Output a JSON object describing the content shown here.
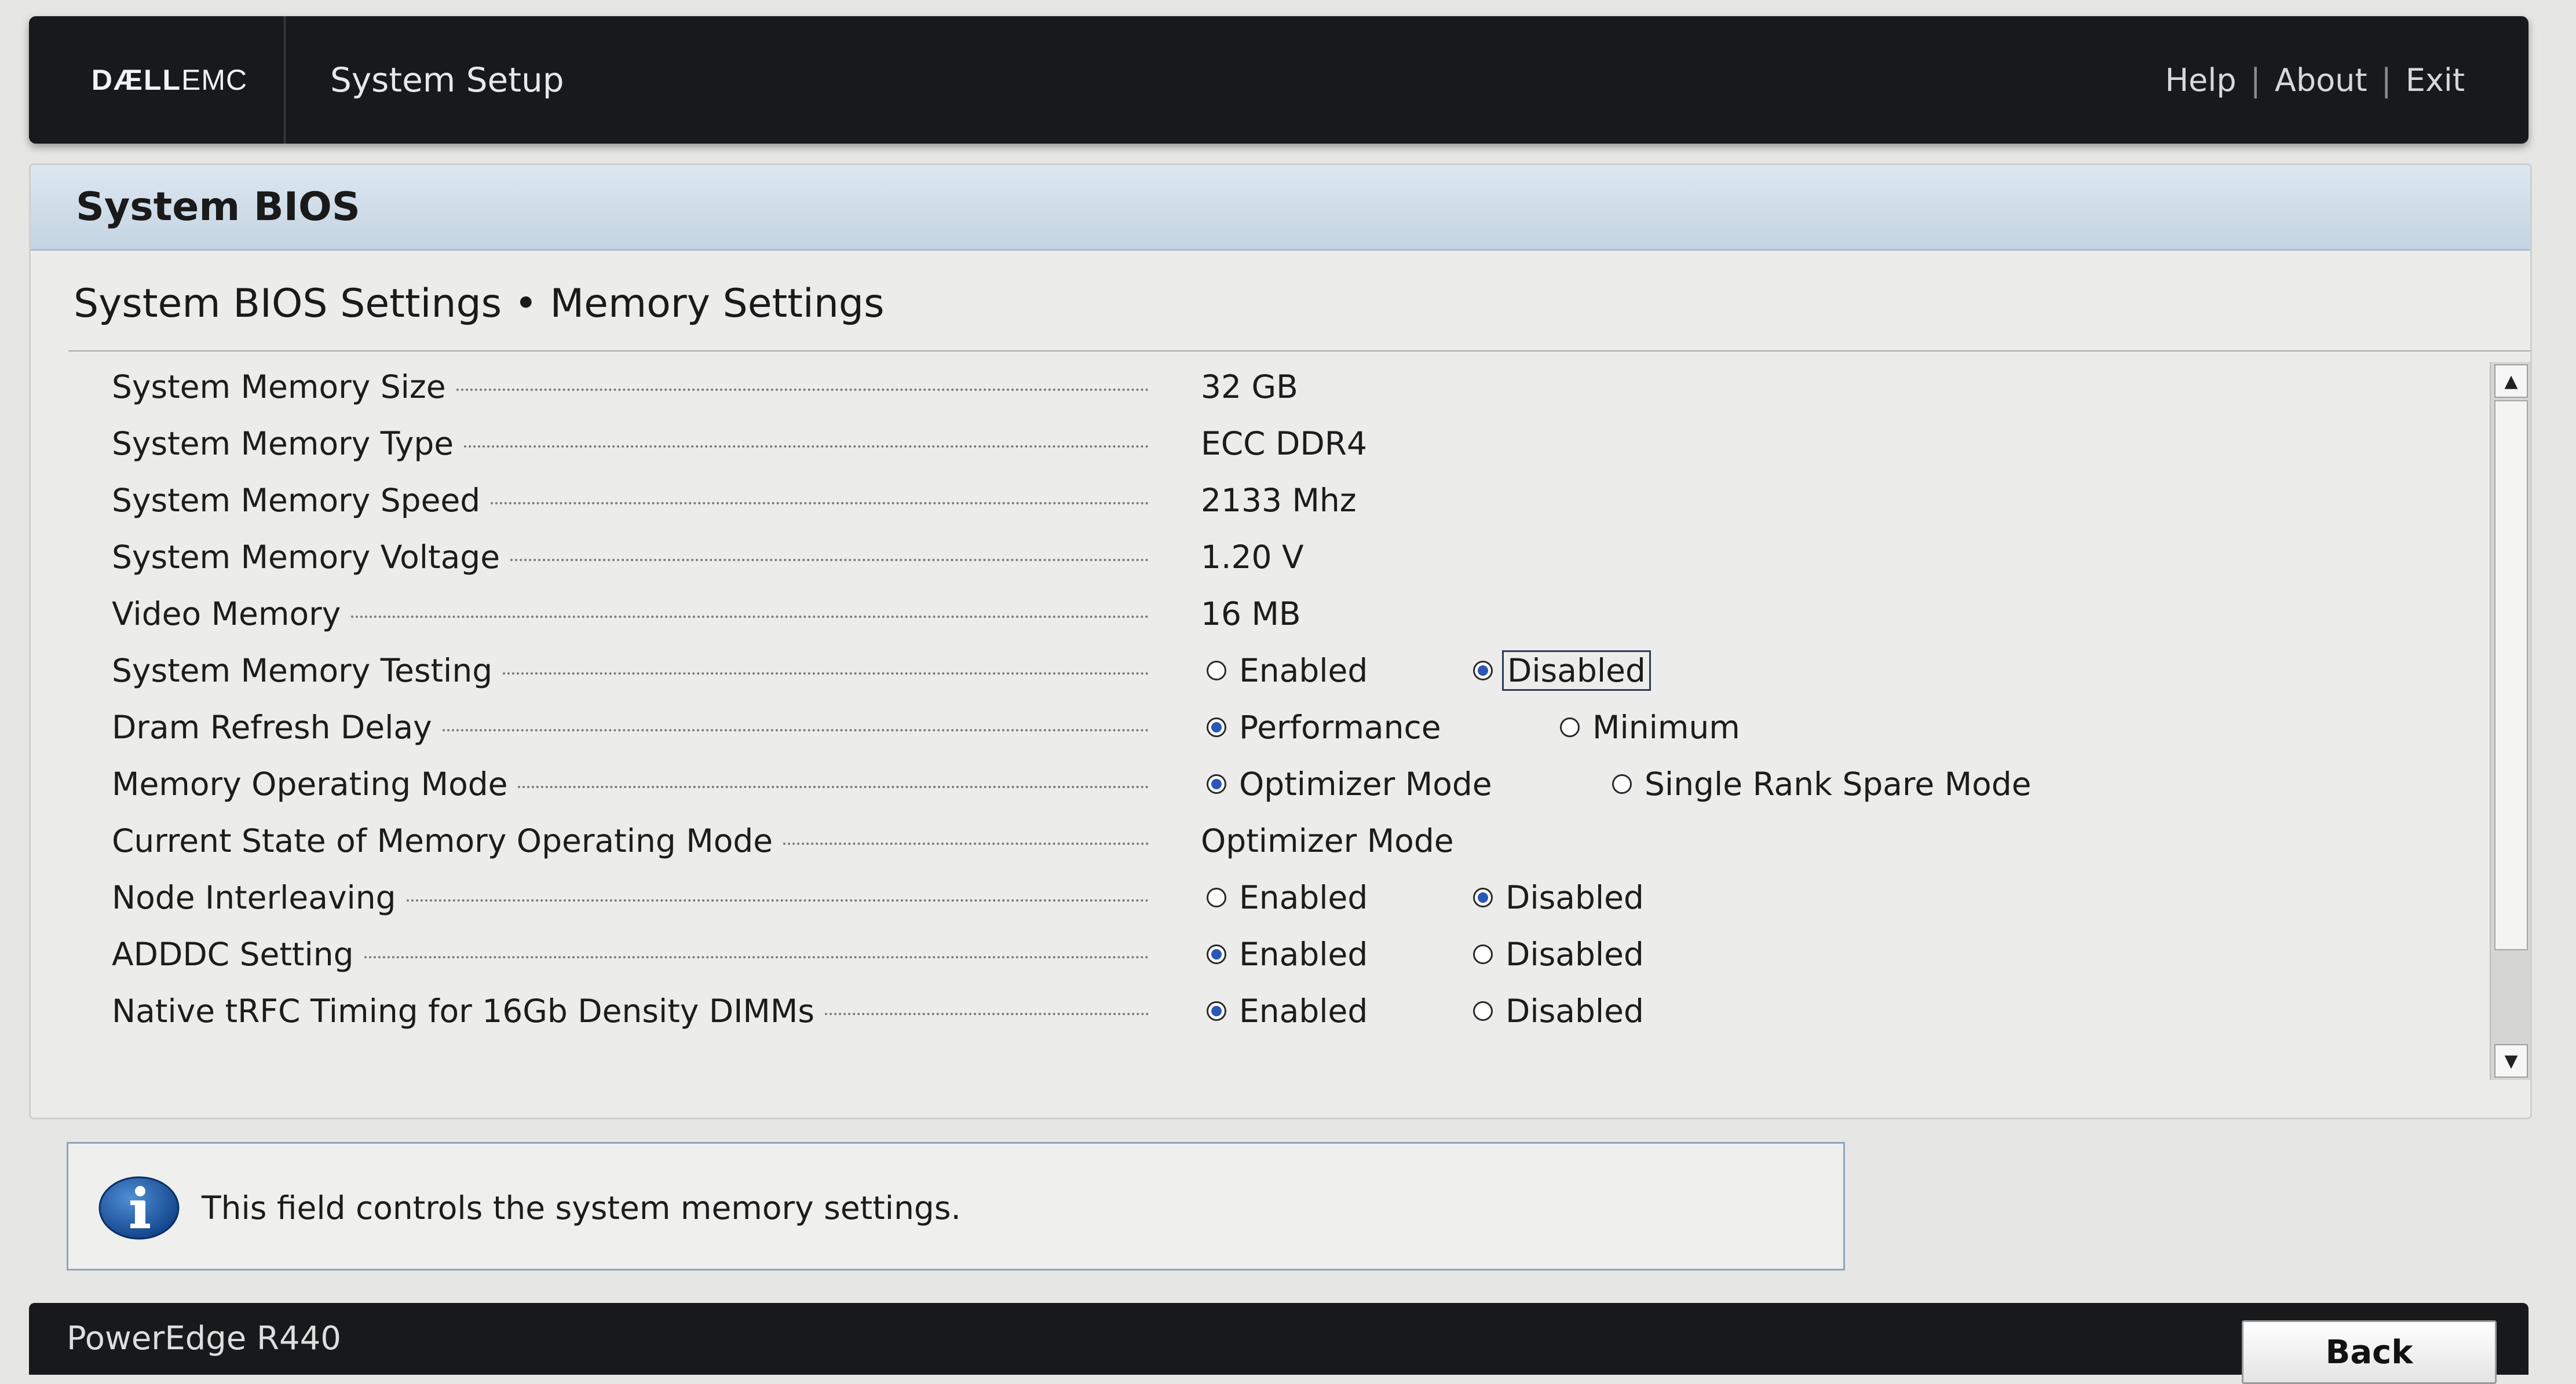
{
  "header": {
    "brand_bold": "DÆLL",
    "brand_light": "EMC",
    "app_title": "System Setup",
    "links": {
      "help": "Help",
      "about": "About",
      "exit": "Exit",
      "separator": "|"
    }
  },
  "panel": {
    "title": "System BIOS",
    "heading": "System BIOS Settings • Memory Settings"
  },
  "settings": [
    {
      "label": "System Memory Size",
      "value": "32 GB"
    },
    {
      "label": "System Memory Type",
      "value": "ECC DDR4"
    },
    {
      "label": "System Memory Speed",
      "value": "2133 Mhz"
    },
    {
      "label": "System Memory Voltage",
      "value": "1.20 V"
    },
    {
      "label": "Video Memory",
      "value": "16 MB"
    },
    {
      "label": "System Memory Testing",
      "options": [
        "Enabled",
        "Disabled"
      ],
      "selected": "Disabled",
      "focused": true
    },
    {
      "label": "Dram Refresh Delay",
      "options": [
        "Performance",
        "Minimum"
      ],
      "selected": "Performance"
    },
    {
      "label": "Memory Operating Mode",
      "options": [
        "Optimizer Mode",
        "Single Rank Spare Mode"
      ],
      "selected": "Optimizer Mode"
    },
    {
      "label": "Current State of Memory Operating Mode",
      "value": "Optimizer Mode"
    },
    {
      "label": "Node Interleaving",
      "options": [
        "Enabled",
        "Disabled"
      ],
      "selected": "Disabled"
    },
    {
      "label": "ADDDC Setting",
      "options": [
        "Enabled",
        "Disabled"
      ],
      "selected": "Enabled"
    },
    {
      "label": "Native tRFC Timing for 16Gb Density DIMMs",
      "options": [
        "Enabled",
        "Disabled"
      ],
      "selected": "Enabled"
    }
  ],
  "help": {
    "icon": "info-icon",
    "text": "This field controls the system memory settings."
  },
  "footer": {
    "model": "PowerEdge R440",
    "back_label": "Back"
  },
  "colors": {
    "accent": "#2b58b5",
    "bar": "#18191b",
    "header_band": "#c4d4e2"
  }
}
